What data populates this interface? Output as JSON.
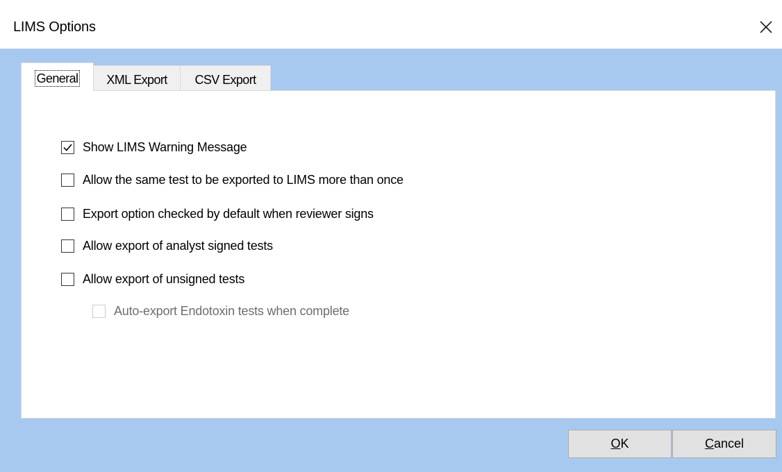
{
  "window": {
    "title": "LIMS Options",
    "close_icon": "close-icon"
  },
  "tabs": [
    {
      "label": "General",
      "active": true
    },
    {
      "label": "XML Export",
      "active": false
    },
    {
      "label": "CSV Export",
      "active": false
    }
  ],
  "options": [
    {
      "label": "Show LIMS Warning Message",
      "checked": true,
      "enabled": true
    },
    {
      "label": "Allow the same test to be exported to LIMS more than once",
      "checked": false,
      "enabled": true
    },
    {
      "label": "Export option checked by default when reviewer signs",
      "checked": false,
      "enabled": true
    },
    {
      "label": "Allow export of analyst signed tests",
      "checked": false,
      "enabled": true
    },
    {
      "label": "Allow export of unsigned tests",
      "checked": false,
      "enabled": true
    },
    {
      "label": "Auto-export Endotoxin tests when complete",
      "checked": false,
      "enabled": false
    }
  ],
  "buttons": {
    "ok": {
      "accel": "O",
      "rest": "K"
    },
    "cancel": {
      "accel": "C",
      "rest": "ancel"
    }
  },
  "colors": {
    "dialog_background": "#a8c9ef",
    "panel_background": "#ffffff",
    "button_face": "#e1e1e1"
  }
}
